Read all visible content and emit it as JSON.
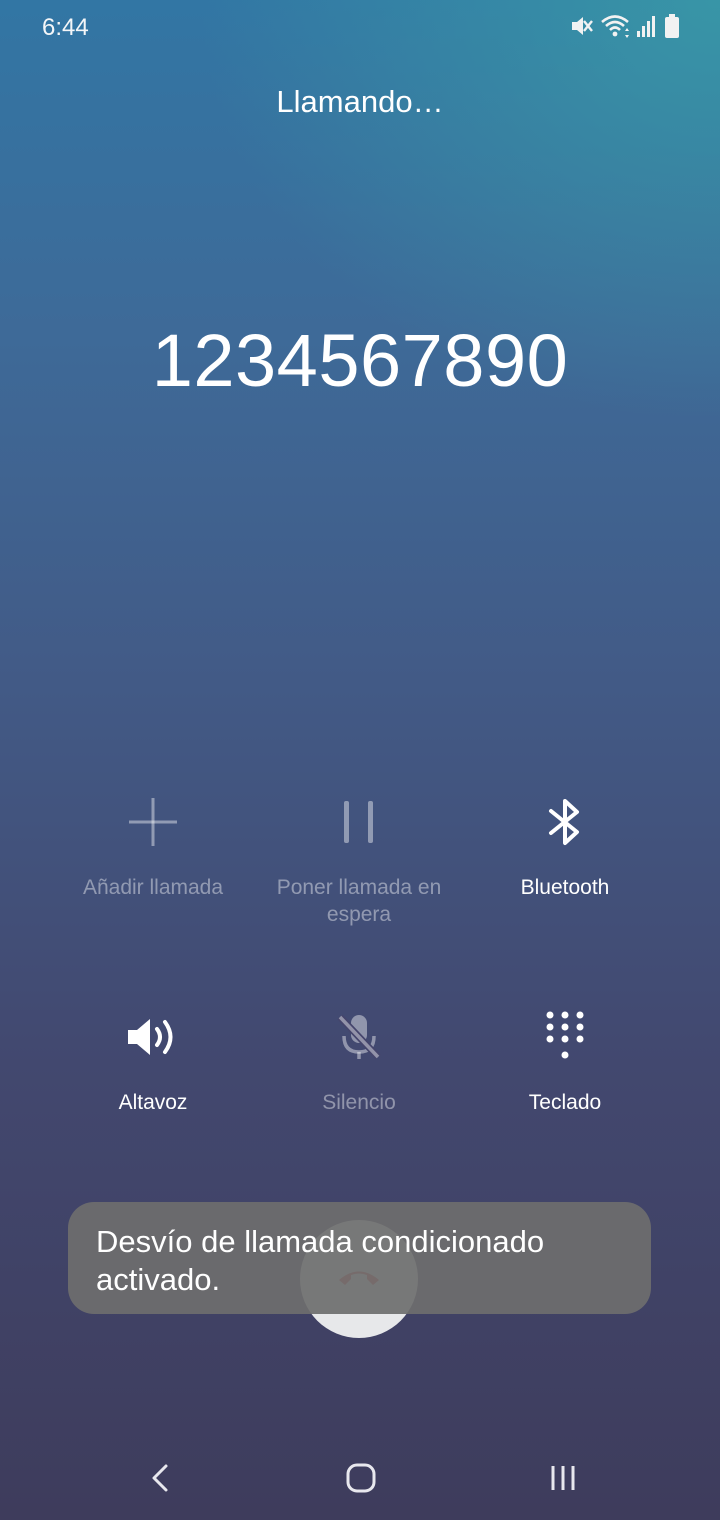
{
  "status_bar": {
    "time": "6:44",
    "icons": [
      "mute-icon",
      "wifi-icon",
      "signal-icon",
      "battery-icon"
    ]
  },
  "call": {
    "status": "Llamando…",
    "number": "1234567890"
  },
  "controls": [
    {
      "label": "Añadir llamada",
      "icon": "add-call-icon",
      "enabled": false
    },
    {
      "label": "Poner llamada en espera",
      "icon": "pause-icon",
      "enabled": false
    },
    {
      "label": "Bluetooth",
      "icon": "bluetooth-icon",
      "enabled": true
    },
    {
      "label": "Altavoz",
      "icon": "speaker-icon",
      "enabled": true
    },
    {
      "label": "Silencio",
      "icon": "mic-off-icon",
      "enabled": false
    },
    {
      "label": "Teclado",
      "icon": "keypad-icon",
      "enabled": true
    }
  ],
  "toast": {
    "message": "Desvío de llamada condicionado activado."
  },
  "end_call": {
    "icon": "end-call-icon",
    "color": "#d9534a"
  },
  "nav": {
    "icons": [
      "back-icon",
      "home-icon",
      "recents-icon"
    ]
  }
}
